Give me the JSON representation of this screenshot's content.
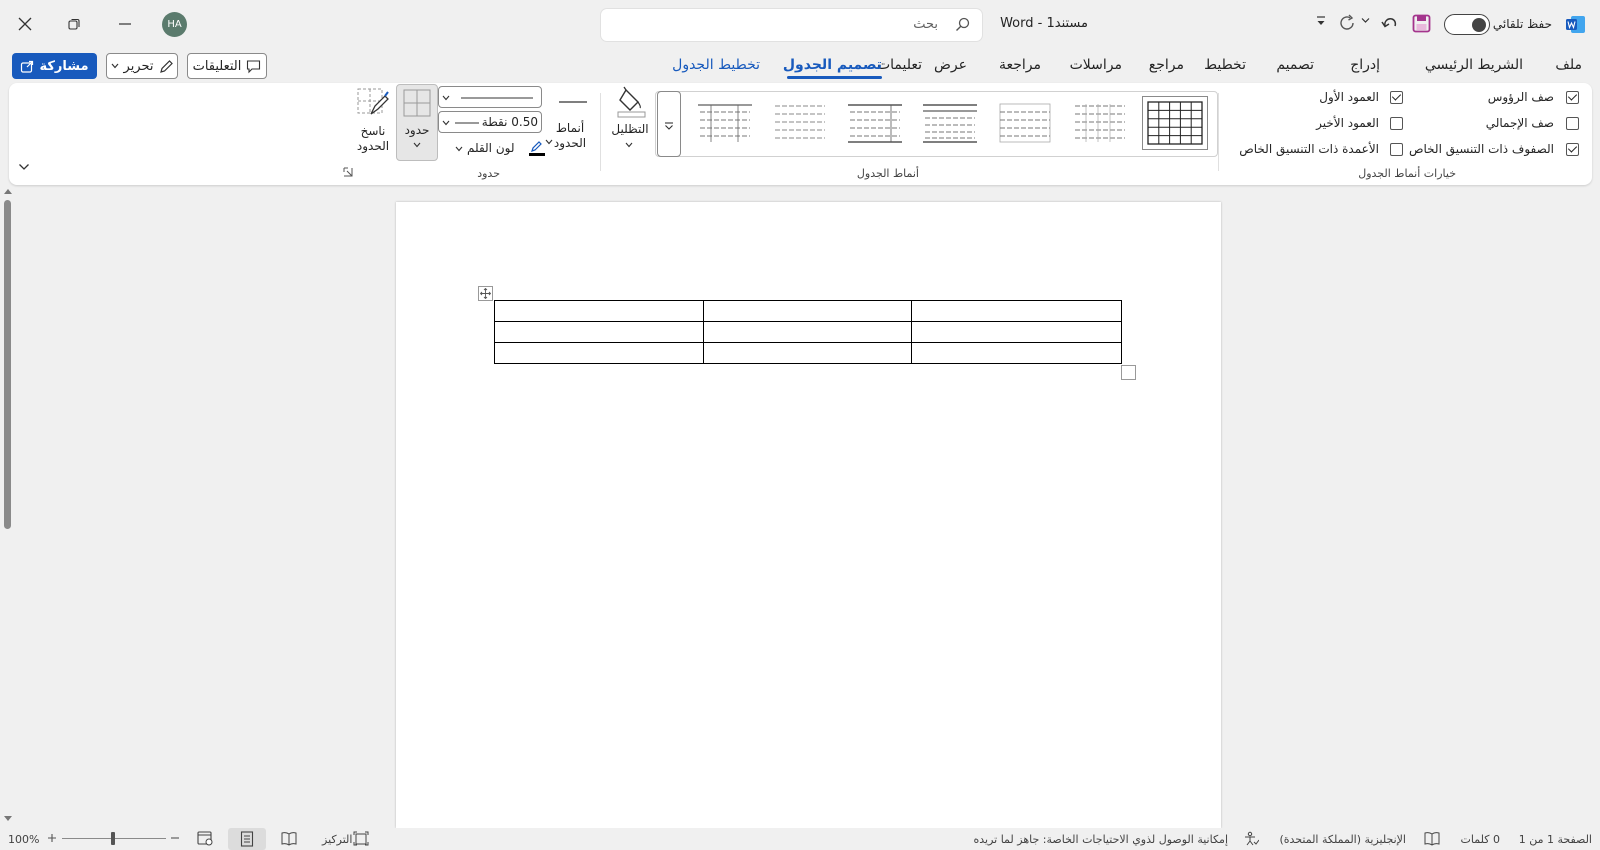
{
  "titlebar": {
    "autosave_label": "حفظ تلقائي",
    "doc_title": "مستند1  -  Word",
    "search_placeholder": "بحث",
    "avatar_initials": "HA"
  },
  "tabs": [
    {
      "label": "ملف"
    },
    {
      "label": "الشريط الرئيسي"
    },
    {
      "label": "إدراج"
    },
    {
      "label": "تصميم"
    },
    {
      "label": "تخطيط"
    },
    {
      "label": "مراجع"
    },
    {
      "label": "مراسلات"
    },
    {
      "label": "مراجعة"
    },
    {
      "label": "عرض"
    },
    {
      "label": "تعليمات"
    },
    {
      "label": "تصميم الجدول",
      "active": true
    },
    {
      "label": "تخطيط الجدول"
    }
  ],
  "actions": {
    "comments_label": "التعليقات",
    "editing_label": "تحرير",
    "share_label": "مشاركة"
  },
  "ribbon": {
    "style_options": {
      "group_label": "خيارات أنماط الجدول",
      "header_row": {
        "label": "صف الرؤوس",
        "checked": true
      },
      "total_row": {
        "label": "صف الإجمالي",
        "checked": false
      },
      "banded_rows": {
        "label": "الصفوف ذات التنسيق الخاص",
        "checked": true
      },
      "first_column": {
        "label": "العمود الأول",
        "checked": true
      },
      "last_column": {
        "label": "العمود الأخير",
        "checked": false
      },
      "banded_columns": {
        "label": "الأعمدة ذات التنسيق الخاص",
        "checked": false
      }
    },
    "table_styles": {
      "group_label": "أنماط الجدول",
      "shading_label": "التظليل"
    },
    "borders": {
      "group_label": "حدود",
      "border_styles_label": "أنماط الحدود",
      "line_weight_value": "0.50 نقطة",
      "pen_color_label": "لون القلم",
      "borders_label": "حدود",
      "border_painter_label": "ناسخ الحدود"
    }
  },
  "statusbar": {
    "page_info": "الصفحة 1 من 1",
    "word_count": "0 كلمات",
    "language": "الإنجليزية (المملكة المتحدة)",
    "accessibility": "إمكانية الوصول لذوي الاحتياجات الخاصة: جاهز لما تريده",
    "focus_label": "التركيز",
    "zoom_level": "100%"
  },
  "colors": {
    "accent": "#185abd",
    "background": "#f0f0f0",
    "avatar": "#5b7b6d",
    "word_logo": "#185abd"
  }
}
